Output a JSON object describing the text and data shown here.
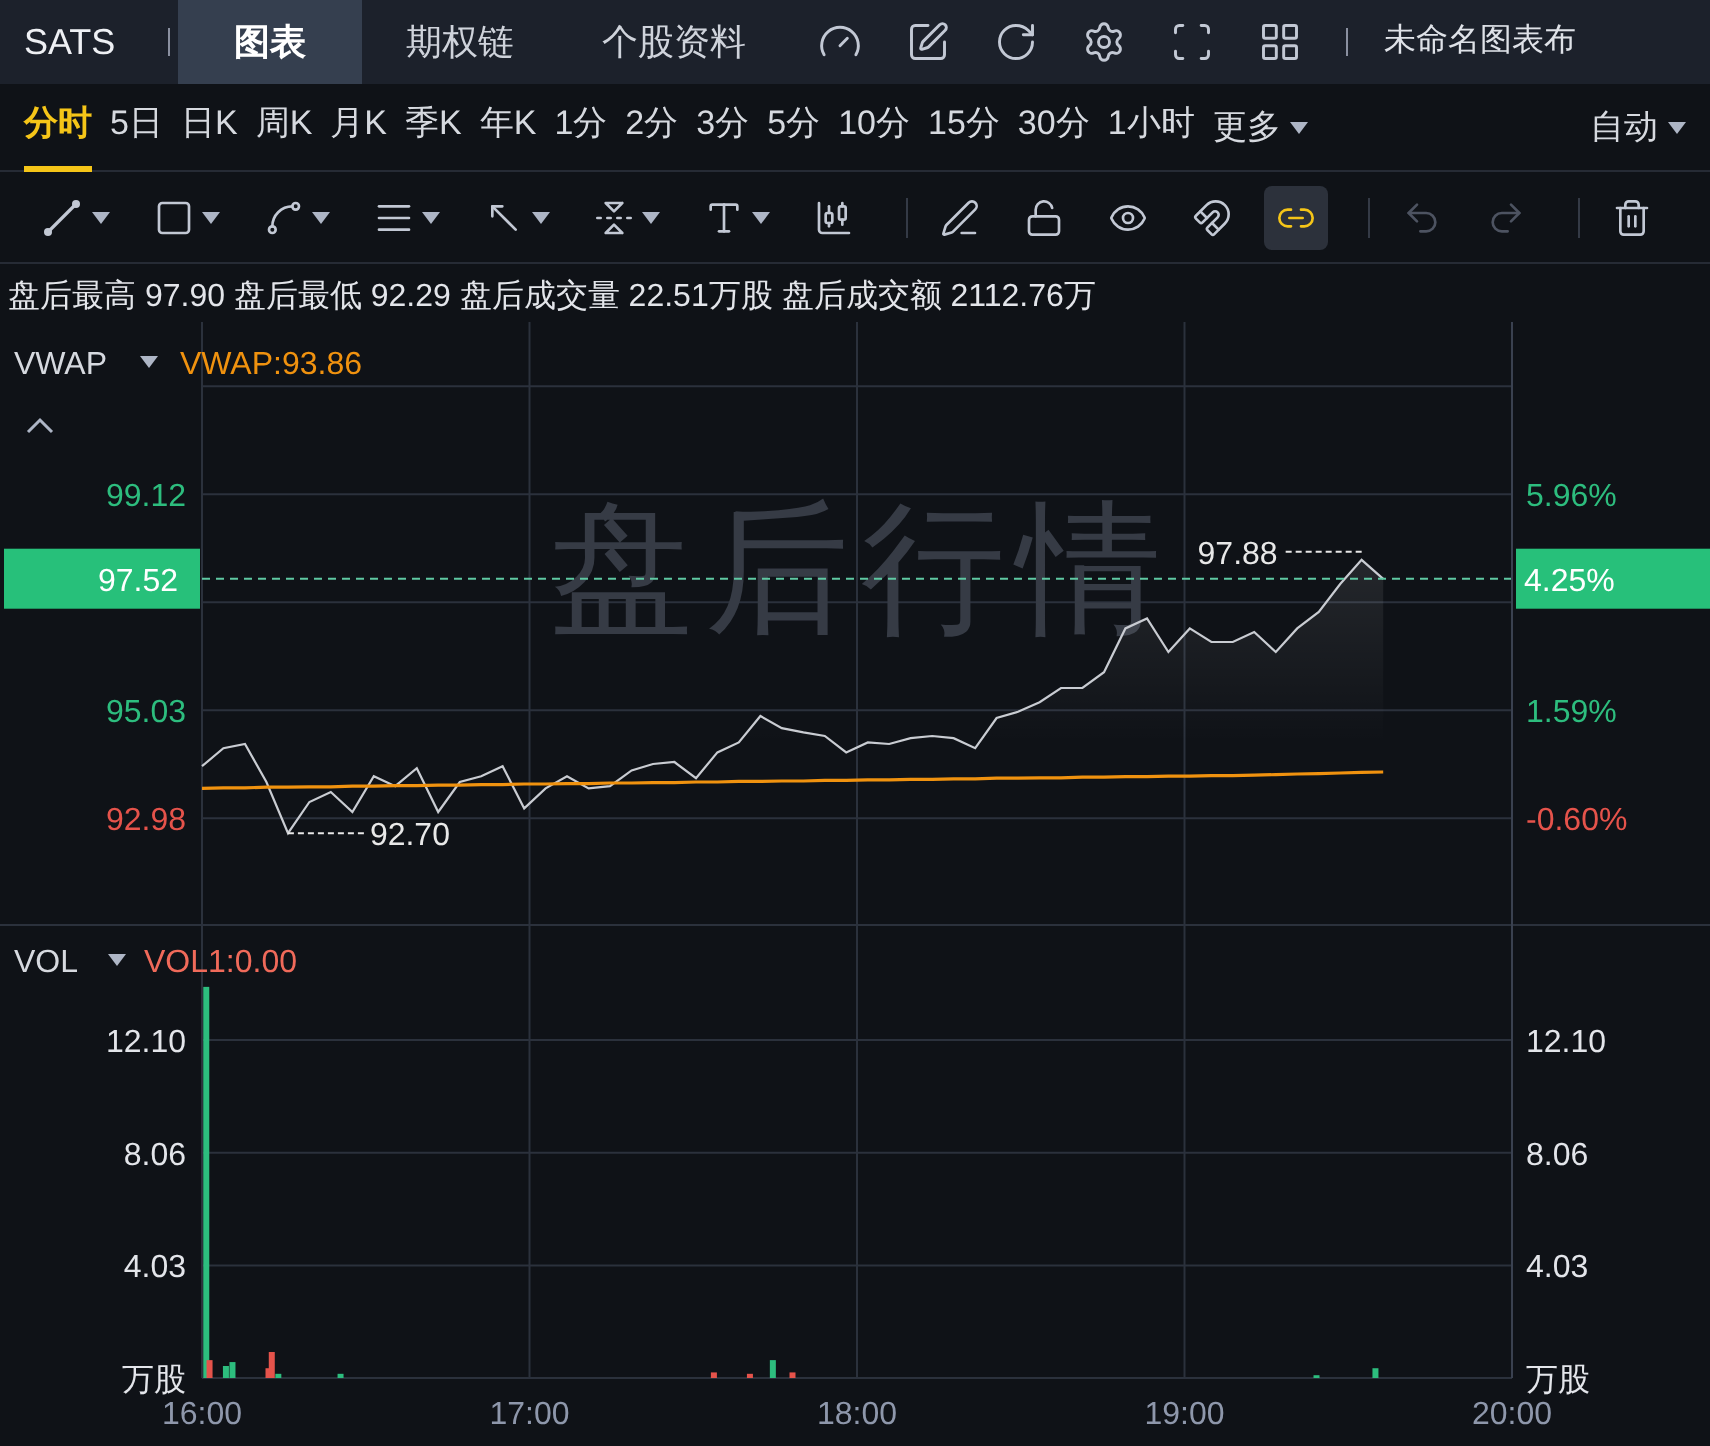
{
  "top_bar": {
    "symbol": "SATS",
    "tabs": [
      {
        "label": "图表",
        "selected": true
      },
      {
        "label": "期权链",
        "selected": false
      },
      {
        "label": "个股资料",
        "selected": false
      }
    ],
    "layout_name": "未命名图表布"
  },
  "periods": [
    {
      "label": "分时",
      "selected": true
    },
    {
      "label": "5日",
      "selected": false
    },
    {
      "label": "日K",
      "selected": false
    },
    {
      "label": "周K",
      "selected": false
    },
    {
      "label": "月K",
      "selected": false
    },
    {
      "label": "季K",
      "selected": false
    },
    {
      "label": "年K",
      "selected": false
    },
    {
      "label": "1分",
      "selected": false
    },
    {
      "label": "2分",
      "selected": false
    },
    {
      "label": "3分",
      "selected": false
    },
    {
      "label": "5分",
      "selected": false
    },
    {
      "label": "10分",
      "selected": false
    },
    {
      "label": "15分",
      "selected": false
    },
    {
      "label": "30分",
      "selected": false
    },
    {
      "label": "1小时",
      "selected": false
    }
  ],
  "more_menu": "更多",
  "scale_mode": "自动",
  "toolbar": [
    {
      "kind": "line",
      "menu": true,
      "active": false,
      "disabled": false
    },
    {
      "kind": "rect",
      "menu": true,
      "active": false,
      "disabled": false
    },
    {
      "kind": "wave",
      "menu": true,
      "active": false,
      "disabled": false
    },
    {
      "kind": "fib",
      "menu": true,
      "active": false,
      "disabled": false
    },
    {
      "kind": "arrow",
      "menu": true,
      "active": false,
      "disabled": false
    },
    {
      "kind": "measure",
      "menu": true,
      "active": false,
      "disabled": false
    },
    {
      "kind": "text",
      "menu": true,
      "active": false,
      "disabled": false
    },
    {
      "kind": "candles",
      "menu": false,
      "active": false,
      "disabled": false
    },
    {
      "kind": "sep"
    },
    {
      "kind": "pen",
      "menu": false,
      "active": false,
      "disabled": false
    },
    {
      "kind": "lock",
      "menu": false,
      "active": false,
      "disabled": false
    },
    {
      "kind": "eye",
      "menu": false,
      "active": false,
      "disabled": false
    },
    {
      "kind": "magnet",
      "menu": false,
      "active": false,
      "disabled": false
    },
    {
      "kind": "link",
      "menu": false,
      "active": true,
      "disabled": false
    },
    {
      "kind": "sep"
    },
    {
      "kind": "undo",
      "menu": false,
      "active": false,
      "disabled": true
    },
    {
      "kind": "redo",
      "menu": false,
      "active": false,
      "disabled": true
    },
    {
      "kind": "sep"
    },
    {
      "kind": "trash",
      "menu": false,
      "active": false,
      "disabled": false
    }
  ],
  "summary": "盘后最高 97.90 盘后最低 92.29 盘后成交量 22.51万股 盘后成交额 2112.76万",
  "price_pane": {
    "indicator": "VWAP",
    "indicator_value": "VWAP:93.86",
    "watermark": "盘后行情",
    "last_change": "4.25%",
    "chart_data": {
      "type": "line",
      "grid": true,
      "ylim": [
        90.98,
        101.17
      ],
      "y2lim": [
        -2.75,
        8.15
      ],
      "ref_lines": [
        {
          "axis": "y",
          "value": 97.52,
          "label": "97.52"
        }
      ],
      "yticks": [
        {
          "value": 99.12,
          "label": "99.12"
        },
        {
          "value": 95.03,
          "label": "95.03"
        },
        {
          "value": 92.98,
          "label": "92.98"
        }
      ],
      "y2ticks": [
        {
          "value": 5.96,
          "label": "5.96%"
        },
        {
          "value": 1.59,
          "label": "1.59%"
        },
        {
          "value": -0.6,
          "label": "-0.60%"
        }
      ],
      "series": [
        {
          "color": "#c9ccd2",
          "values": [
            93.97,
            94.31,
            94.39,
            93.67,
            92.7,
            93.29,
            93.48,
            93.1,
            93.78,
            93.59,
            93.93,
            93.1,
            93.67,
            93.78,
            93.97,
            93.17,
            93.55,
            93.78,
            93.55,
            93.59,
            93.89,
            94.01,
            94.05,
            93.74,
            94.23,
            94.42,
            94.92,
            94.69,
            94.61,
            94.54,
            94.23,
            94.42,
            94.39,
            94.5,
            94.54,
            94.5,
            94.31,
            94.88,
            95.0,
            95.18,
            95.45,
            95.45,
            95.75,
            96.58,
            96.77,
            96.13,
            96.58,
            96.32,
            96.32,
            96.51,
            96.13,
            96.58,
            96.89,
            97.42,
            97.88,
            97.52,
            null,
            null,
            null,
            null,
            null,
            null
          ]
        },
        {
          "color": "#f0920f",
          "values": [
            93.55,
            93.56,
            93.56,
            93.57,
            93.57,
            93.58,
            93.58,
            93.59,
            93.59,
            93.6,
            93.6,
            93.61,
            93.61,
            93.62,
            93.62,
            93.63,
            93.63,
            93.64,
            93.64,
            93.65,
            93.65,
            93.66,
            93.66,
            93.67,
            93.67,
            93.68,
            93.68,
            93.69,
            93.69,
            93.7,
            93.7,
            93.71,
            93.71,
            93.72,
            93.72,
            93.73,
            93.73,
            93.74,
            93.74,
            93.75,
            93.75,
            93.76,
            93.76,
            93.77,
            93.77,
            93.78,
            93.78,
            93.79,
            93.79,
            93.8,
            93.81,
            93.82,
            93.83,
            93.84,
            93.85,
            93.86,
            null,
            null,
            null,
            null,
            null,
            null
          ]
        }
      ],
      "annotations": [
        "92.70",
        "97.88"
      ]
    }
  },
  "volume_pane": {
    "indicator": "VOL",
    "indicator_value": "VOL1:0.00",
    "unit_left": "万股",
    "unit_right": "万股",
    "chart_data": {
      "type": "bar",
      "grid": true,
      "xlim": [
        16,
        20
      ],
      "ylim": [
        0,
        16.25
      ],
      "yticks": [
        {
          "value": 12.1,
          "label": "12.10"
        },
        {
          "value": 8.06,
          "label": "8.06"
        },
        {
          "value": 4.03,
          "label": "4.03"
        }
      ],
      "xticks": [
        {
          "value": 16,
          "label": "16:00"
        },
        {
          "value": 17,
          "label": "17:00"
        },
        {
          "value": 18,
          "label": "18:00"
        },
        {
          "value": 19,
          "label": "19:00"
        },
        {
          "value": 20,
          "label": "20:00"
        }
      ],
      "x": [
        16.01,
        16.02,
        16.07,
        16.09,
        16.2,
        16.21,
        16.23,
        16.42,
        17.56,
        17.67,
        17.74,
        17.8,
        19.4,
        19.58
      ],
      "series": [
        {
          "color": "#2dbd7e",
          "values": [
            14.0,
            null,
            0.43,
            0.57,
            null,
            null,
            0.15,
            0.15,
            null,
            null,
            0.64,
            null,
            0.1,
            0.35
          ]
        },
        {
          "color": "#e5534b",
          "values": [
            null,
            0.64,
            null,
            null,
            0.35,
            0.93,
            null,
            null,
            0.2,
            0.15,
            null,
            0.2,
            null,
            null
          ]
        }
      ]
    }
  }
}
